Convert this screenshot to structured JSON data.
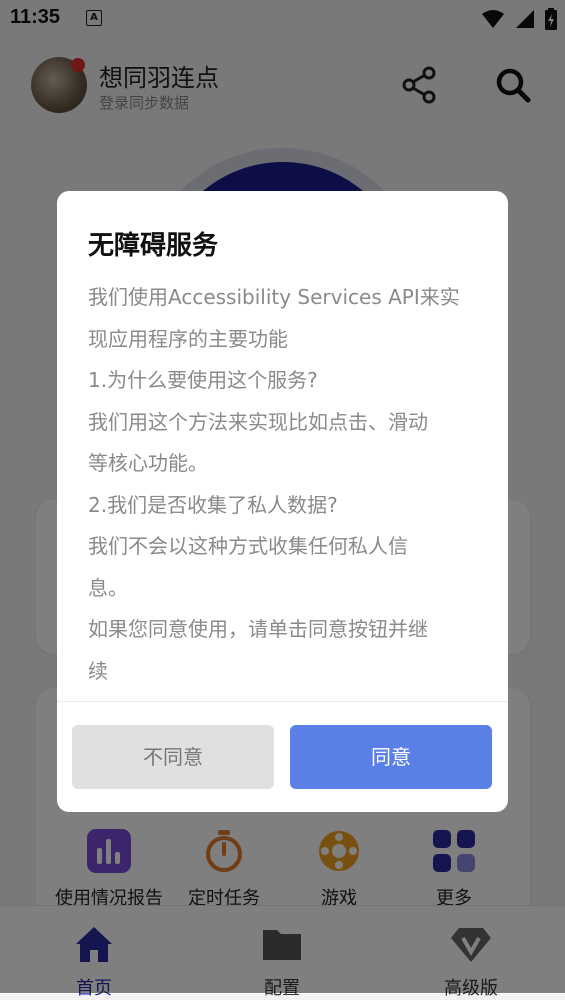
{
  "status_bar": {
    "time": "11:35",
    "indicator": "A"
  },
  "header": {
    "title": "想同羽连点",
    "subtitle": "登录同步数据"
  },
  "quick_actions": [
    {
      "label": "使用情况报告",
      "icon": "bar-chart-icon"
    },
    {
      "label": "定时任务",
      "icon": "stopwatch-icon"
    },
    {
      "label": "游戏",
      "icon": "game-wheel-icon"
    },
    {
      "label": "更多",
      "icon": "grid-icon"
    }
  ],
  "bottom_nav": [
    {
      "label": "首页",
      "icon": "home-icon",
      "active": true
    },
    {
      "label": "配置",
      "icon": "folder-icon",
      "active": false
    },
    {
      "label": "高级版",
      "icon": "diamond-v-icon",
      "active": false
    }
  ],
  "dialog": {
    "title": "无障碍服务",
    "lines": [
      "我们使用Accessibility Services API来实",
      "现应用程序的主要功能",
      "1.为什么要使用这个服务?",
      "我们用这个方法来实现比如点击、滑动",
      "等核心功能。",
      "2.我们是否收集了私人数据?",
      "我们不会以这种方式收集任何私人信",
      "息。",
      "如果您同意使用，请单击同意按钮并继",
      "续"
    ],
    "disagree_label": "不同意",
    "agree_label": "同意"
  },
  "colors": {
    "accent": "#5a7fe6",
    "primary_dark": "#2a2aa0",
    "scrim": "rgba(0,0,0,0.5)"
  }
}
